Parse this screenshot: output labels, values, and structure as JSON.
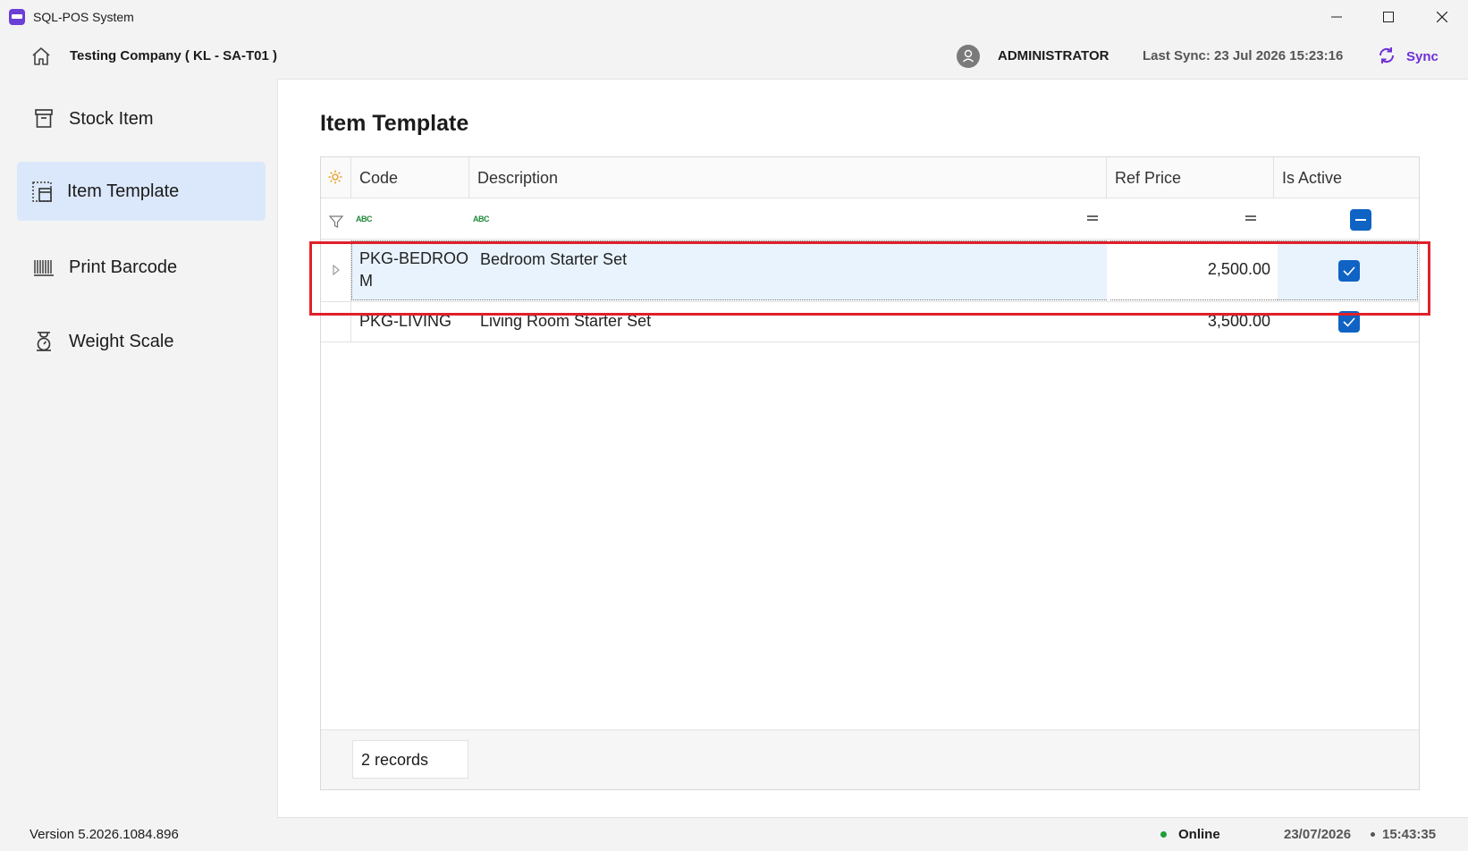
{
  "window": {
    "title": "SQL-POS System"
  },
  "header": {
    "company": "Testing Company ( KL - SA-T01 )",
    "user": "ADMINISTRATOR",
    "last_sync": "Last Sync: 23 Jul 2026 15:23:16",
    "sync_label": "Sync"
  },
  "sidebar": {
    "items": [
      {
        "label": "Stock Item",
        "icon": "archive-box-icon"
      },
      {
        "label": "Item Template",
        "icon": "template-icon",
        "active": true
      },
      {
        "label": "Print Barcode",
        "icon": "barcode-icon"
      },
      {
        "label": "Weight Scale",
        "icon": "weight-scale-icon"
      }
    ]
  },
  "main": {
    "title": "Item Template",
    "columns": [
      "Code",
      "Description",
      "Ref Price",
      "Is Active"
    ],
    "filter_abc": "ABC",
    "rows": [
      {
        "code_line1": "PKG-BEDROO",
        "code_line2": "M",
        "description": "Bedroom Starter Set",
        "ref_price": "2,500.00",
        "is_active": true
      },
      {
        "code": "PKG-LIVING",
        "description": "Living Room Starter Set",
        "ref_price": "3,500.00",
        "is_active": true
      }
    ],
    "records": "2 records"
  },
  "status": {
    "version": "Version 5.2026.1084.896",
    "connection": "Online",
    "date": "23/07/2026",
    "time": "15:43:35"
  },
  "colors": {
    "accent": "#0f63c4",
    "sync": "#6f2fd8",
    "highlight": "#e0202a",
    "active_nav": "#dbe8fb",
    "online": "#1f9e3a"
  }
}
